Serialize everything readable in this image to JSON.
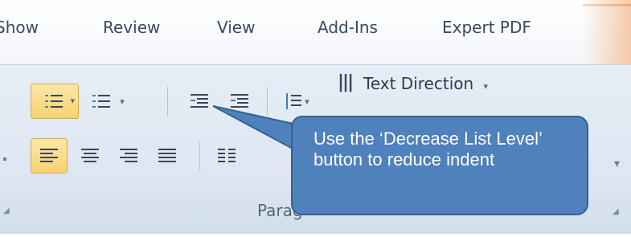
{
  "tabs": [
    {
      "label": "Show"
    },
    {
      "label": "Review"
    },
    {
      "label": "View"
    },
    {
      "label": "Add-Ins"
    },
    {
      "label": "Expert PDF"
    }
  ],
  "ribbon": {
    "text_direction_label": "Text Direction",
    "group_label": "Parag",
    "dropdown_glyph": "▾"
  },
  "callout": {
    "text": "Use the ‘Decrease List Level’ button to reduce indent"
  },
  "colors": {
    "callout_fill": "#4f81bd",
    "active_button": "#f9d271"
  },
  "icons": [
    "bullets-icon",
    "numbering-icon",
    "decrease-indent-icon",
    "increase-indent-icon",
    "line-spacing-icon",
    "text-direction-icon",
    "align-left-icon",
    "center-icon",
    "align-right-icon",
    "justify-icon",
    "columns-icon"
  ]
}
